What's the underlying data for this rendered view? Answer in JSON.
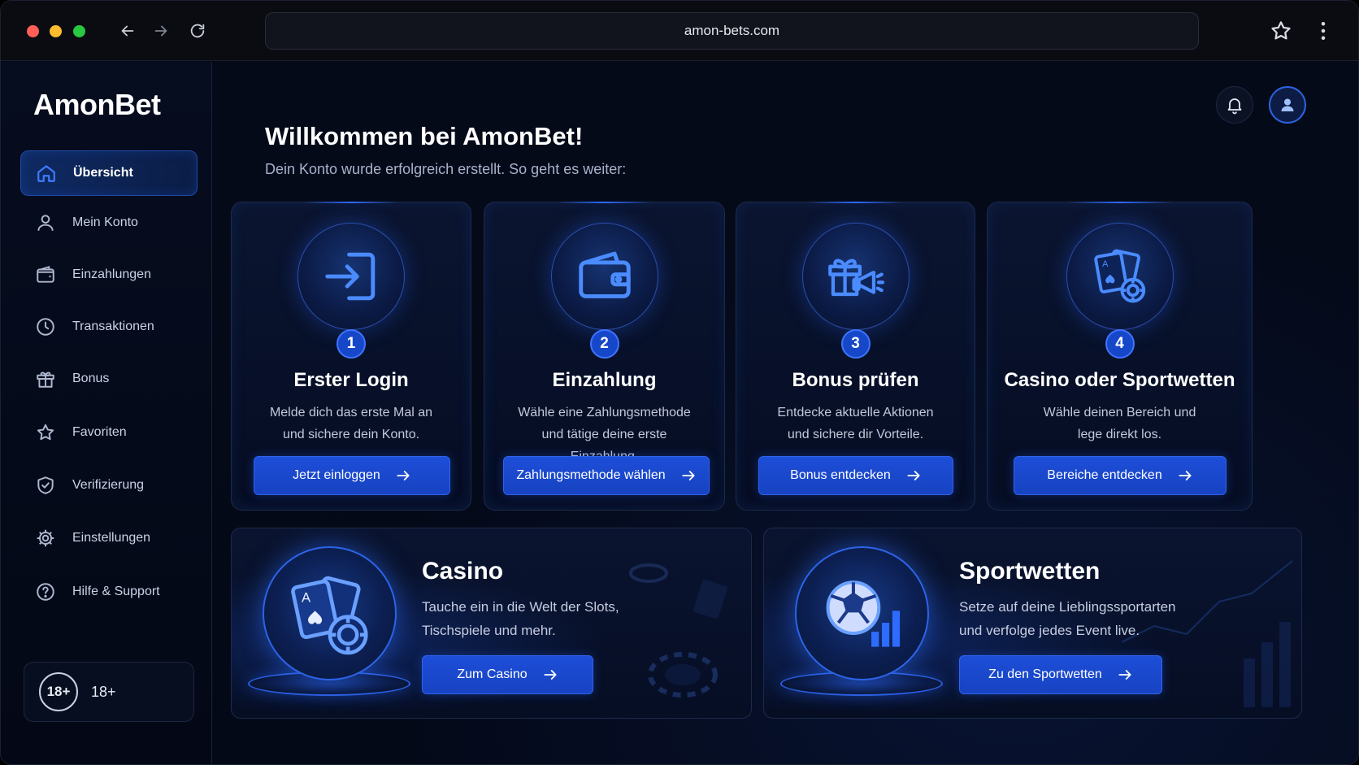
{
  "browser": {
    "url": "amon-bets.com"
  },
  "brand": "AmonBet",
  "sidebar": {
    "items": [
      {
        "label": "Übersicht",
        "icon": "home-icon",
        "active": true
      },
      {
        "label": "Mein Konto",
        "icon": "user-icon",
        "active": false
      },
      {
        "label": "Einzahlungen",
        "icon": "wallet-icon",
        "active": false
      },
      {
        "label": "Transaktionen",
        "icon": "clock-icon",
        "active": false
      },
      {
        "label": "Bonus",
        "icon": "gift-icon",
        "active": false
      },
      {
        "label": "Favoriten",
        "icon": "star-icon",
        "active": false
      },
      {
        "label": "Verifizierung",
        "icon": "shield-check-icon",
        "active": false
      },
      {
        "label": "Einstellungen",
        "icon": "gear-icon",
        "active": false
      },
      {
        "label": "Hilfe & Support",
        "icon": "help-icon",
        "active": false
      }
    ],
    "age_badge": "18+",
    "age_label": "18+"
  },
  "main": {
    "title": "Willkommen bei AmonBet!",
    "subtitle": "Dein Konto wurde erfolgreich erstellt. So geht es weiter:",
    "steps": [
      {
        "number": "1",
        "title": "Erster Login",
        "desc_line1": "Melde dich das erste Mal an",
        "desc_line2": "und sichere dein Konto.",
        "button": "Jetzt einloggen",
        "icon": "login-icon"
      },
      {
        "number": "2",
        "title": "Einzahlung",
        "desc_line1": "Wähle eine Zahlungsmethode",
        "desc_line2": "und tätige deine erste Einzahlung.",
        "button": "Zahlungsmethode wählen",
        "icon": "wallet-icon"
      },
      {
        "number": "3",
        "title": "Bonus prüfen",
        "desc_line1": "Entdecke aktuelle Aktionen",
        "desc_line2": "und sichere dir Vorteile.",
        "button": "Bonus entdecken",
        "icon": "gift-megaphone-icon"
      },
      {
        "number": "4",
        "title": "Casino oder Sportwetten",
        "desc_line1": "Wähle deinen Bereich und",
        "desc_line2": "lege direkt los.",
        "button": "Bereiche entdecken",
        "icon": "cards-chip-icon"
      }
    ],
    "casino": {
      "title": "Casino",
      "desc_line1": "Tauche ein in die Welt der Slots,",
      "desc_line2": "Tischspiele und mehr.",
      "button": "Zum Casino"
    },
    "sports": {
      "title": "Sportwetten",
      "desc_line1": "Setze auf deine Lieblingssportarten",
      "desc_line2": "und verfolge jedes Event live.",
      "button": "Zu den Sportwetten"
    }
  },
  "colors": {
    "accent": "#1d4ed8",
    "background": "#050a17",
    "active_nav": "#0f2a63"
  }
}
